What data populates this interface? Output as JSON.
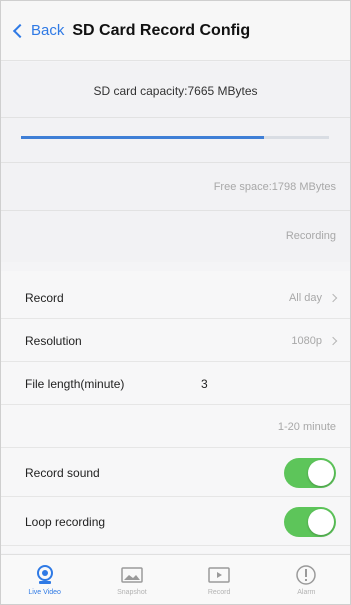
{
  "nav": {
    "back_label": "Back",
    "title": "SD Card Record Config"
  },
  "storage": {
    "capacity_text": "SD card capacity:7665 MBytes",
    "used_fraction": 0.79,
    "free_space_text": "Free space:1798 MBytes",
    "status_text": "Recording"
  },
  "settings": {
    "record": {
      "label": "Record",
      "value": "All day"
    },
    "resolution": {
      "label": "Resolution",
      "value": "1080p"
    },
    "file_length": {
      "label": "File length(minute)",
      "value": "3",
      "hint": "1-20 minute"
    },
    "record_sound": {
      "label": "Record sound",
      "enabled": true
    },
    "loop_recording": {
      "label": "Loop recording",
      "enabled": true
    }
  },
  "tabs": [
    {
      "label": "Live Video",
      "icon": "camera-icon",
      "active": true
    },
    {
      "label": "Snapshot",
      "icon": "picture-icon",
      "active": false
    },
    {
      "label": "Record",
      "icon": "film-icon",
      "active": false
    },
    {
      "label": "Alarm",
      "icon": "info-icon",
      "active": false
    }
  ],
  "colors": {
    "accent": "#2f7ae5",
    "toggle_on": "#5dc55a",
    "progress": "#3f7fd6"
  }
}
